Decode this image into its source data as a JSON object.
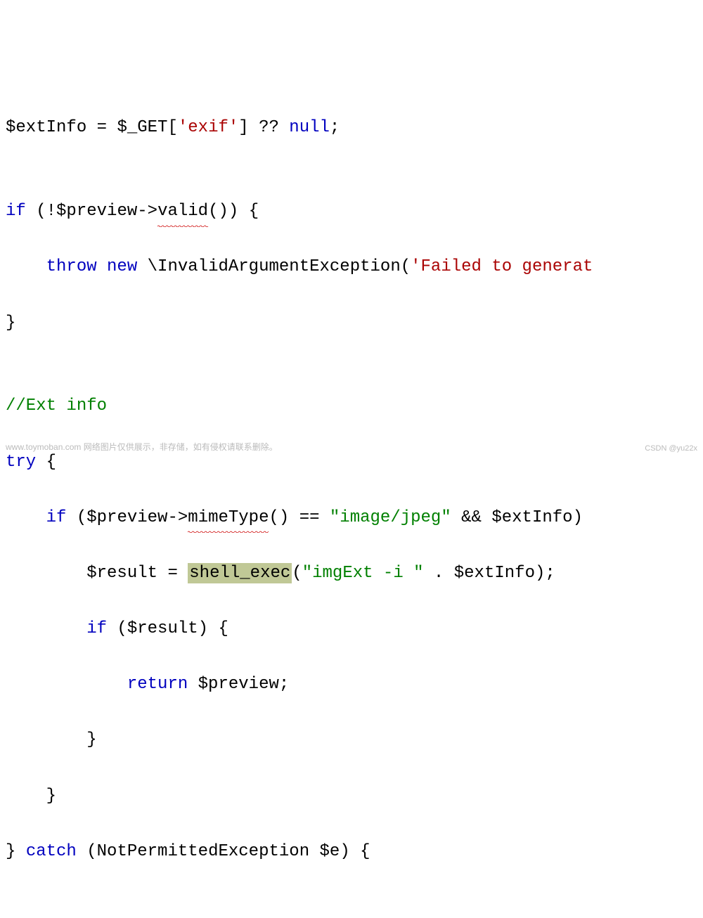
{
  "code": {
    "line1": {
      "var1": "$extInfo",
      "assign": " = ",
      "var2": "$_GET",
      "bracket": "[",
      "str": "'exif'",
      "bracket2": "]",
      "op": " ?? ",
      "null": "null",
      "semi": ";"
    },
    "line3": {
      "if": "if",
      "open": " (!",
      "var": "$preview",
      "arrow": "->",
      "method": "valid",
      "call": "()) {"
    },
    "line4": {
      "throw": "throw",
      "sp1": " ",
      "new": "new",
      "sp2": " ",
      "class": "\\InvalidArgumentException",
      "open": "(",
      "str": "'Failed to generat"
    },
    "line5": {
      "close": "}"
    },
    "line7": {
      "comment": "//Ext info"
    },
    "line8": {
      "try": "try",
      "brace": " {"
    },
    "line9": {
      "if": "if",
      "open": " (",
      "var": "$preview",
      "arrow": "->",
      "method": "mimeType",
      "call": "() == ",
      "str": "\"image/jpeg\"",
      "and": " && ",
      "var2": "$extInfo",
      "close": ")"
    },
    "line10": {
      "var": "$result",
      "assign": " = ",
      "func": "shell_exec",
      "open": "(",
      "str": "\"imgExt -i \"",
      "concat": " . ",
      "var2": "$extInfo",
      "close": ");"
    },
    "line11": {
      "if": "if",
      "open": " (",
      "var": "$result",
      "close": ") {"
    },
    "line12": {
      "return": "return",
      "sp": " ",
      "var": "$preview",
      "semi": ";"
    },
    "line13": {
      "close": "}"
    },
    "line14": {
      "close": "}"
    },
    "line15": {
      "close": "} ",
      "catch": "catch",
      "open": " (",
      "class": "NotPermittedException",
      "sp": " ",
      "var": "$e",
      "close2": ") {"
    }
  },
  "watermark_left": "www.toymoban.com 网络图片仅供展示，非存储，如有侵权请联系删除。",
  "watermark_right": "CSDN @yu22x"
}
